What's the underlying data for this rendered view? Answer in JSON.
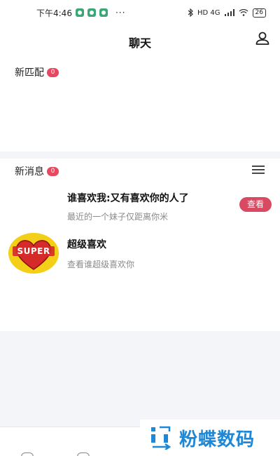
{
  "status_bar": {
    "time": "下午4:46",
    "more": "···",
    "network": "HD 4G",
    "battery": "26"
  },
  "header": {
    "title": "聊天"
  },
  "matches": {
    "title": "新匹配",
    "count": "0"
  },
  "messages": {
    "title": "新消息",
    "count": "0",
    "items": [
      {
        "title": "谁喜欢我:又有喜欢你的人了",
        "subtitle": "最近的一个妹子仅距离你米",
        "action": "查看"
      },
      {
        "title": "超级喜欢",
        "subtitle": "查看谁超级喜欢你",
        "avatar_text": "SUPER"
      }
    ]
  },
  "watermark": {
    "text": "粉蝶数码"
  },
  "colors": {
    "accent": "#d94a62",
    "badge": "#e8475f",
    "watermark": "#1e87d6",
    "super_bg": "#f4cf17"
  },
  "icons": [
    "user-icon",
    "menu-icon",
    "super-heart-icon"
  ]
}
